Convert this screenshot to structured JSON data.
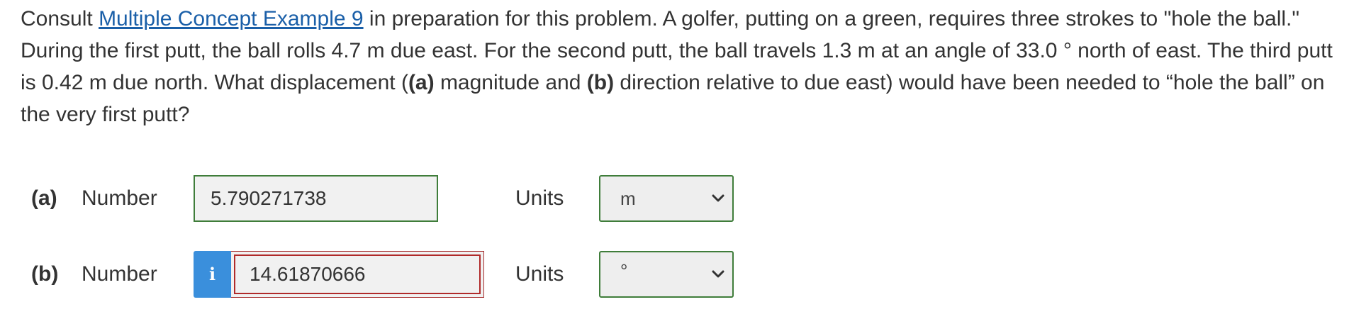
{
  "question": {
    "intro": "Consult ",
    "link_text": "Multiple Concept Example 9",
    "text_1": " in preparation for this problem. A golfer, putting on a green, requires three strokes to \"hole the ball.\" During the first putt, the ball rolls 4.7 m due east. For the second putt, the ball travels 1.3 m at an angle of 33.0 ° north of east. The third putt is 0.42 m due north. What displacement (",
    "bold_a": "(a)",
    "text_2": " magnitude and ",
    "bold_b": "(b)",
    "text_3": " direction relative to due east) would have been needed to “hole the ball” on the very first putt?"
  },
  "parts": {
    "a": {
      "label": "(a)",
      "number_label": "Number",
      "value": "5.790271738",
      "units_label": "Units",
      "units_value": "m",
      "status_color": "#3f7d3a"
    },
    "b": {
      "label": "(b)",
      "number_label": "Number",
      "info_icon_text": "i",
      "value": "14.61870666",
      "units_label": "Units",
      "units_value": "°",
      "status_color": "#b02a2a"
    }
  },
  "colors": {
    "link": "#1a5fa8",
    "info_button": "#3a8fdc",
    "correct_border": "#3f7d3a",
    "incorrect_border": "#b02a2a"
  },
  "icons": {
    "info": "info-icon",
    "dropdown": "chevron-down-icon"
  }
}
